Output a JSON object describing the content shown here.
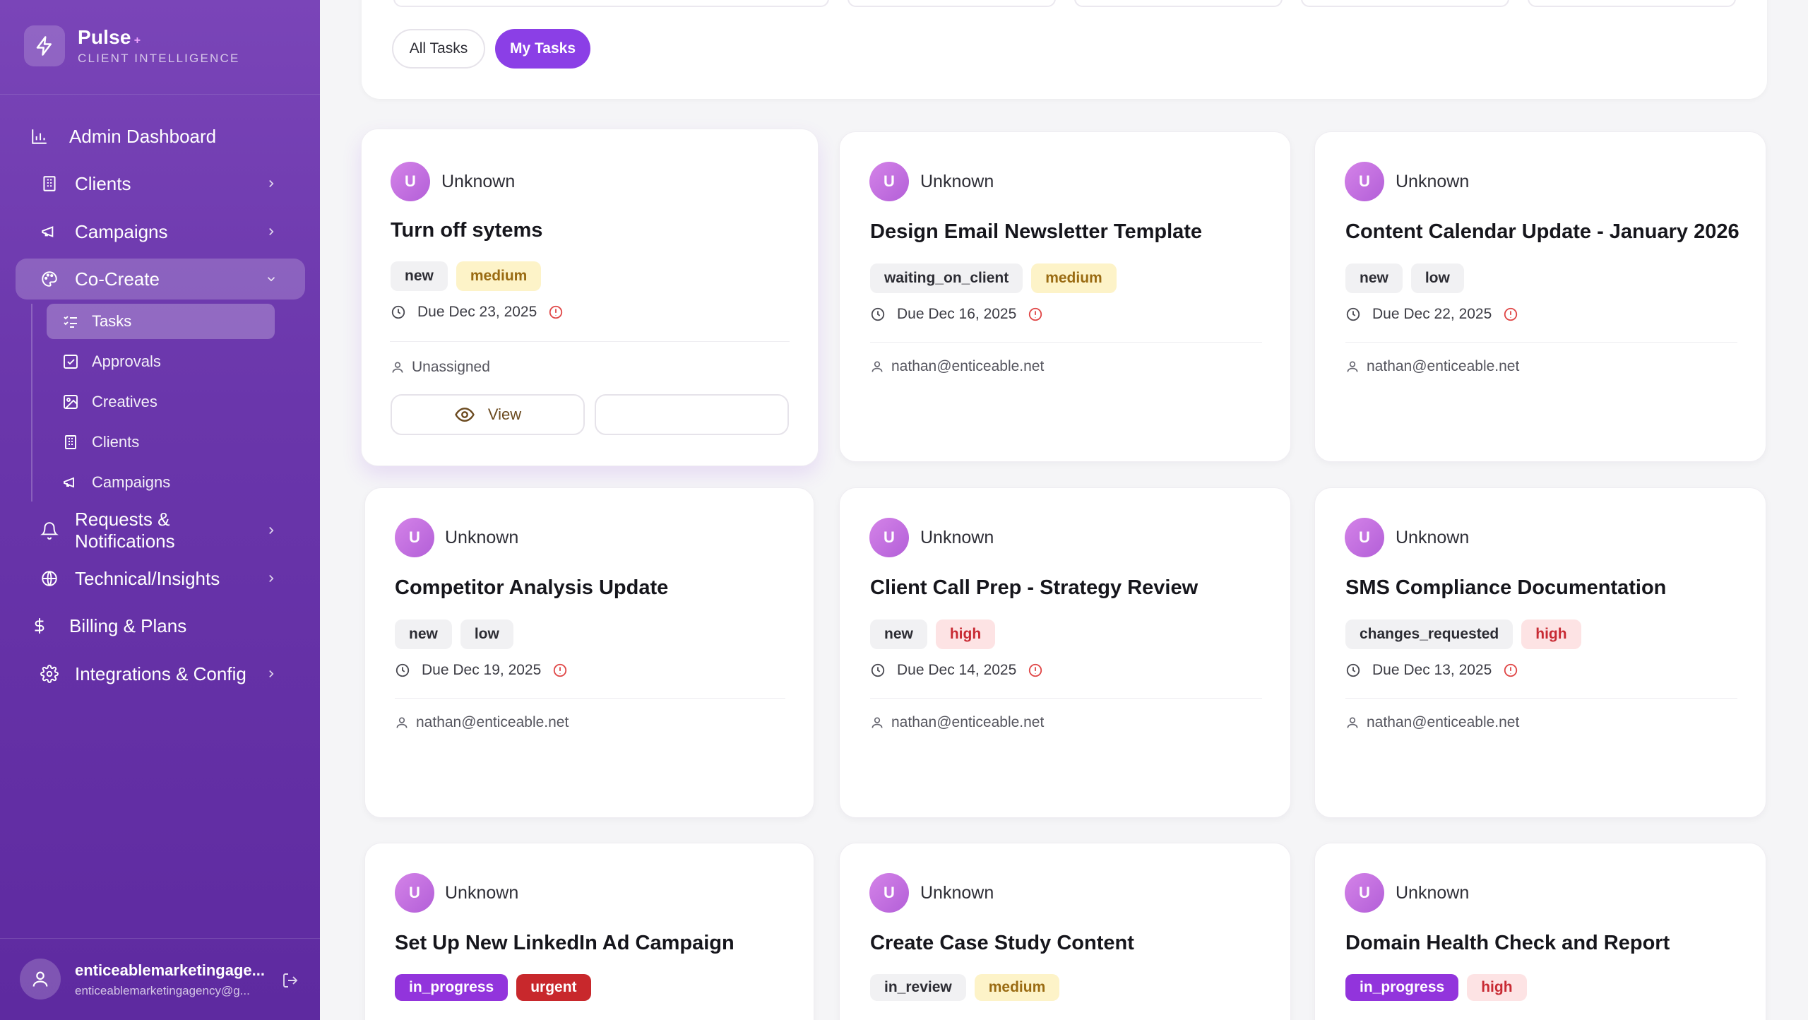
{
  "brand": {
    "name": "Pulse",
    "plus": "+",
    "subtitle": "CLIENT INTELLIGENCE"
  },
  "nav": {
    "admin_dashboard": "Admin Dashboard",
    "clients": "Clients",
    "campaigns": "Campaigns",
    "cocreate": "Co-Create",
    "sub": {
      "tasks": "Tasks",
      "approvals": "Approvals",
      "creatives": "Creatives",
      "clients": "Clients",
      "campaigns": "Campaigns"
    },
    "requests_line1": "Requests &",
    "requests_line2": "Notifications",
    "technical": "Technical/Insights",
    "billing": "Billing & Plans",
    "integrations": "Integrations & Config"
  },
  "user": {
    "name": "enticeablemarketingage...",
    "email": "enticeablemarketingagency@g..."
  },
  "filters": {
    "all_tasks": "All Tasks",
    "my_tasks": "My Tasks"
  },
  "colors": {
    "accent": "#8b3fe6",
    "sidebar": "#6a36ab",
    "due_warning": "#e04848"
  },
  "cards": [
    {
      "avatar": "U",
      "owner": "Unknown",
      "title": "Turn off sytems",
      "status": "new",
      "priority": "medium",
      "due": "Due Dec 23, 2025",
      "assignee": "Unassigned",
      "view_label": "View"
    },
    {
      "avatar": "U",
      "owner": "Unknown",
      "title": "Design Email Newsletter Template",
      "status": "waiting_on_client",
      "priority": "medium",
      "due": "Due Dec 16, 2025",
      "assignee": "nathan@enticeable.net"
    },
    {
      "avatar": "U",
      "owner": "Unknown",
      "title": "Content Calendar Update - January 2026",
      "status": "new",
      "priority": "low",
      "due": "Due Dec 22, 2025",
      "assignee": "nathan@enticeable.net"
    },
    {
      "avatar": "U",
      "owner": "Unknown",
      "title": "Competitor Analysis Update",
      "status": "new",
      "priority": "low",
      "due": "Due Dec 19, 2025",
      "assignee": "nathan@enticeable.net"
    },
    {
      "avatar": "U",
      "owner": "Unknown",
      "title": "Client Call Prep - Strategy Review",
      "status": "new",
      "priority": "high",
      "due": "Due Dec 14, 2025",
      "assignee": "nathan@enticeable.net"
    },
    {
      "avatar": "U",
      "owner": "Unknown",
      "title": "SMS Compliance Documentation",
      "status": "changes_requested",
      "priority": "high",
      "due": "Due Dec 13, 2025",
      "assignee": "nathan@enticeable.net"
    },
    {
      "avatar": "U",
      "owner": "Unknown",
      "title": "Set Up New LinkedIn Ad Campaign",
      "status": "in_progress",
      "priority": "urgent"
    },
    {
      "avatar": "U",
      "owner": "Unknown",
      "title": "Create Case Study Content",
      "status": "in_review",
      "priority": "medium"
    },
    {
      "avatar": "U",
      "owner": "Unknown",
      "title": "Domain Health Check and Report",
      "status": "in_progress",
      "priority": "high"
    }
  ]
}
